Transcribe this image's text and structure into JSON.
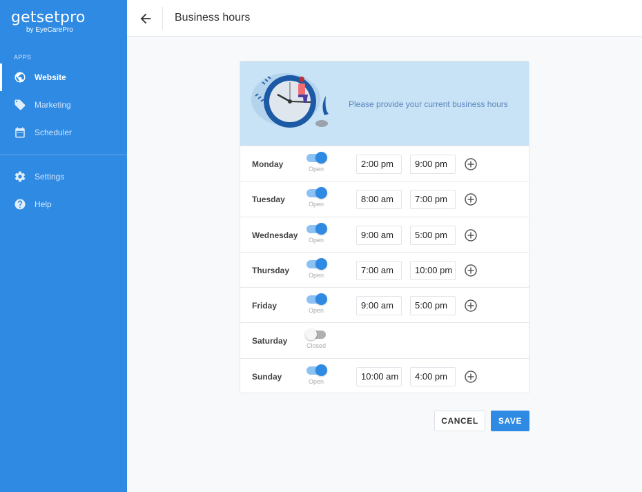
{
  "sidebar": {
    "logo": {
      "main": "getsetpro",
      "sub": "by EyeCarePro"
    },
    "section_label": "APPS",
    "items": [
      {
        "label": "Website",
        "icon": "globe-icon",
        "active": true
      },
      {
        "label": "Marketing",
        "icon": "tag-icon",
        "active": false
      },
      {
        "label": "Scheduler",
        "icon": "calendar-icon",
        "active": false
      },
      {
        "label": "Settings",
        "icon": "gear-icon",
        "active": false
      },
      {
        "label": "Help",
        "icon": "help-icon",
        "active": false
      }
    ]
  },
  "header": {
    "title": "Business hours",
    "back_icon": "arrow-left-icon"
  },
  "banner": {
    "text": "Please provide your current business hours",
    "illustration": "clock-illustration"
  },
  "schedule": [
    {
      "day": "Monday",
      "status": "Open",
      "open": true,
      "from": "2:00 pm",
      "to": "9:00 pm"
    },
    {
      "day": "Tuesday",
      "status": "Open",
      "open": true,
      "from": "8:00 am",
      "to": "7:00 pm"
    },
    {
      "day": "Wednesday",
      "status": "Open",
      "open": true,
      "from": "9:00 am",
      "to": "5:00 pm"
    },
    {
      "day": "Thursday",
      "status": "Open",
      "open": true,
      "from": "7:00 am",
      "to": "10:00 pm"
    },
    {
      "day": "Friday",
      "status": "Open",
      "open": true,
      "from": "9:00 am",
      "to": "5:00 pm"
    },
    {
      "day": "Saturday",
      "status": "Closed",
      "open": false,
      "from": "",
      "to": ""
    },
    {
      "day": "Sunday",
      "status": "Open",
      "open": true,
      "from": "10:00 am",
      "to": "4:00 pm"
    }
  ],
  "actions": {
    "cancel": "CANCEL",
    "save": "SAVE"
  },
  "colors": {
    "accent": "#2f8ae3",
    "banner_bg": "#c8e2f6",
    "toggle_track_on": "#8cc1f4",
    "toggle_track_off": "#b0b0b0"
  }
}
